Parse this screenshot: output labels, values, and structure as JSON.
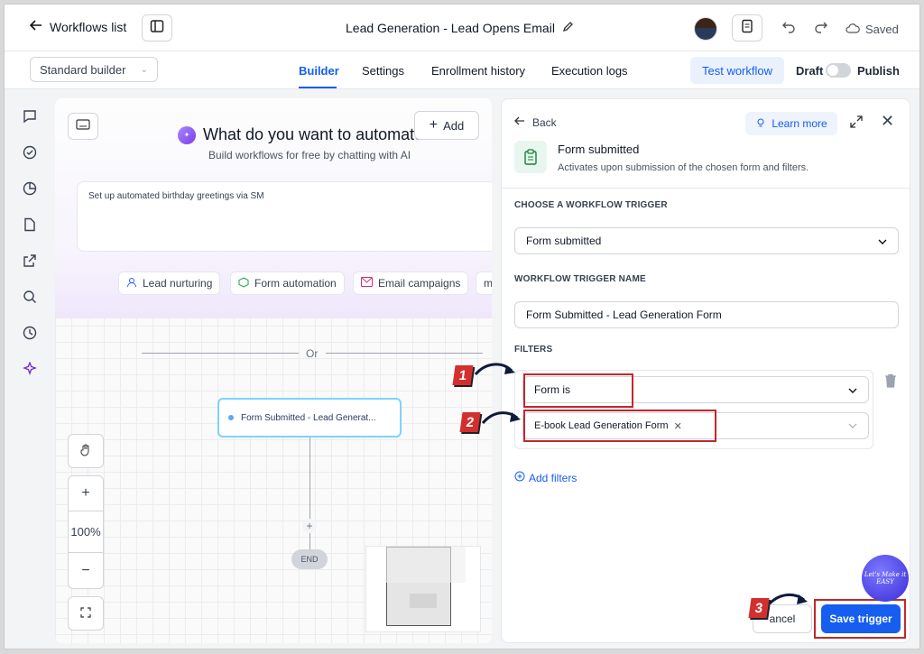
{
  "header": {
    "back_label": "Workflows list",
    "title": "Lead Generation - Lead Opens Email",
    "saved_label": "Saved"
  },
  "subbar": {
    "builder_select": "Standard builder",
    "tabs": [
      "Builder",
      "Settings",
      "Enrollment history",
      "Execution logs"
    ],
    "active_tab": "Builder",
    "test_label": "Test workflow",
    "draft_label": "Draft",
    "publish_label": "Publish"
  },
  "canvas": {
    "add_label": "Add",
    "ai_title": "What do you want to automate",
    "ai_subtitle": "Build workflows for free by chatting with AI",
    "prompt_text": "Set up automated birthday greetings via SM",
    "chips": [
      "Lead nurturing",
      "Form automation",
      "Email campaigns",
      "me"
    ],
    "or_label": "Or",
    "trigger_node": "Form Submitted - Lead Generat...",
    "end_label": "END",
    "zoom": "100%"
  },
  "panel": {
    "back_label": "Back",
    "learn_more": "Learn more",
    "trigger_title": "Form submitted",
    "trigger_desc": "Activates upon submission of the chosen form and filters.",
    "choose_label": "CHOOSE A WORKFLOW TRIGGER",
    "choose_value": "Form submitted",
    "name_label": "WORKFLOW TRIGGER NAME",
    "name_value": "Form Submitted - Lead Generation Form",
    "filters_label": "FILTERS",
    "filter_field": "Form is",
    "filter_value": "E-book Lead Generation Form",
    "add_filters": "Add filters",
    "cancel_label": "ancel",
    "save_label": "Save trigger"
  },
  "annotations": {
    "step1": "1",
    "step2": "2",
    "step3": "3",
    "brand_text": "Let's Make it EASY"
  },
  "colors": {
    "accent": "#155eef",
    "highlight": "#c0282b"
  }
}
